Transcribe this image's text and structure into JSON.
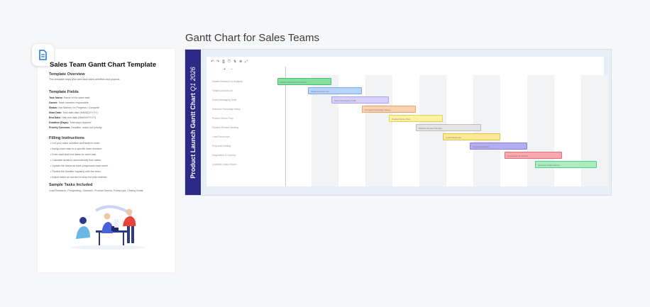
{
  "heading": "Gantt Chart for Sales Teams",
  "colors": {
    "brand_band": "#2c2a86",
    "frame_bg": "#e8eef5",
    "doc_icon_accent": "#1a73e8"
  },
  "doc_panel": {
    "icon": "document-icon",
    "title": "Sales Team Gantt Chart Template",
    "sections": {
      "overview_heading": "Template Overview",
      "overview_text": "This template helps plan and track sales activities and projects.",
      "fields_heading": "Template Fields",
      "fields": [
        {
          "k": "Task Name",
          "v": "Name of the sales task"
        },
        {
          "k": "Owner",
          "v": "Team member responsible"
        },
        {
          "k": "Status",
          "v": "Not Started / In Progress / Complete"
        },
        {
          "k": "Start Date",
          "v": "Task start date (MM/DD/YYYY)"
        },
        {
          "k": "End Date",
          "v": "Task end date (MM/DD/YYYY)"
        },
        {
          "k": "Duration (Days)",
          "v": "Total days required"
        },
        {
          "k": "Priority Columns",
          "v": "Deadline, tasks and priority"
        }
      ],
      "filling_heading": "Filling Instructions",
      "filling": [
        "List your sales activities and tasks in order.",
        "Assign each task to a specific team member.",
        "Enter start and end dates for each task.",
        "Calculate duration automatically from dates.",
        "Update the status as work progresses each week.",
        "Review the timeline regularly with the team.",
        "Adjust dates as needed to keep the plan realistic."
      ],
      "sample_heading": "Sample Tasks Included",
      "sample_text": "Lead Research, Prospecting, Outreach, Product Demos, Follow-ups, Closing Deals"
    }
  },
  "gantt": {
    "side_title": "Product Launch Gantt Chart",
    "side_title_quarter": "Q1 2026",
    "toolbar_icons": [
      "undo-icon",
      "redo-icon",
      "print-icon",
      "filter-icon",
      "sort-icon",
      "link-icon",
      "expand-icon",
      "zoom-in-icon",
      "zoom-out-icon"
    ],
    "tasks": [
      {
        "label": "Market Research & Analysis",
        "color": "#86e0a0",
        "border": "#4bbf73"
      },
      {
        "label": "Target Account List",
        "color": "#b9d4fb",
        "border": "#7eaaf0"
      },
      {
        "label": "Sales Messaging Draft",
        "color": "#d9d1fb",
        "border": "#ada1ee"
      },
      {
        "label": "Outreach Campaign Setup",
        "color": "#fbd2b0",
        "border": "#eaa46b"
      },
      {
        "label": "Product Demo Prep",
        "color": "#fdf1a6",
        "border": "#e5cf54"
      },
      {
        "label": "Pipeline Review Meeting",
        "color": "#e4e4e4",
        "border": "#bdbdbd"
      },
      {
        "label": "Lead Follow-ups",
        "color": "#fde89a",
        "border": "#e2c33a"
      },
      {
        "label": "Proposal Drafting",
        "color": "#b6acf5",
        "border": "#8a7de7"
      },
      {
        "label": "Negotiation & Closing",
        "color": "#f8a9b0",
        "border": "#e56c78"
      },
      {
        "label": "Quarterly Sales Report",
        "color": "#a8ecc0",
        "border": "#5ccd86"
      }
    ]
  }
}
